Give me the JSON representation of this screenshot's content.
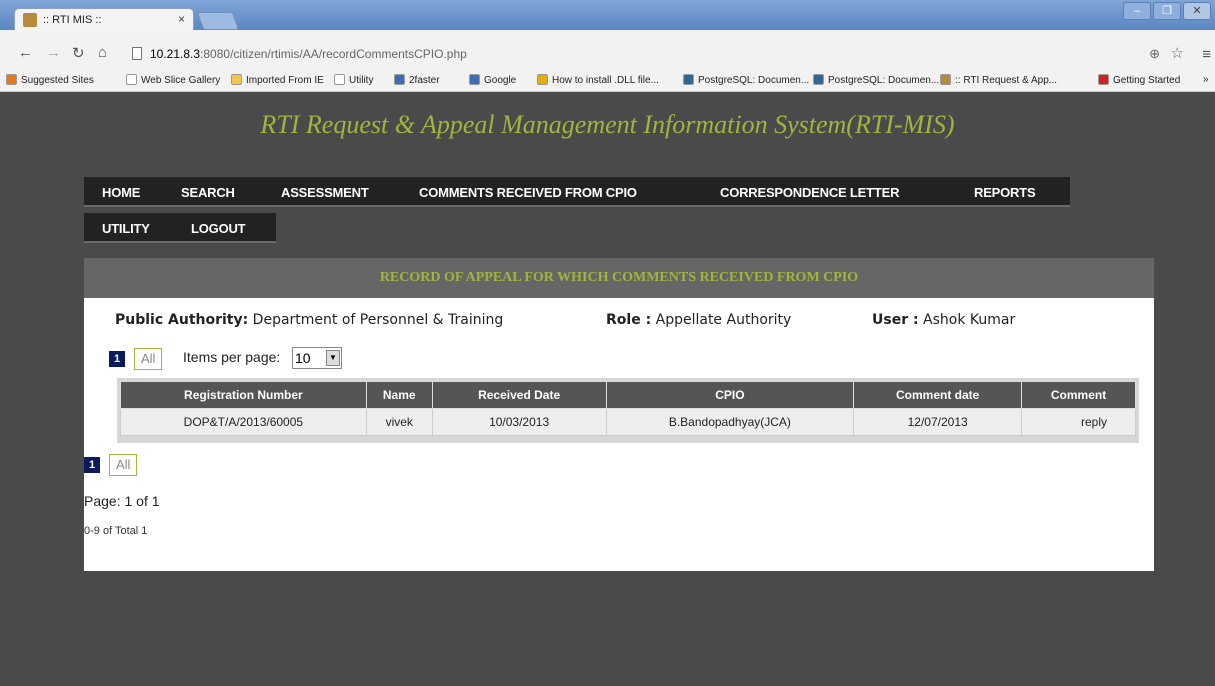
{
  "browser": {
    "tab_title": ":: RTI MIS ::",
    "tab_close": "×",
    "url_host": "10.21.8.3",
    "url_rest": ":8080/citizen/rtimis/AA/recordCommentsCPIO.php",
    "bookmarks": [
      {
        "label": "Suggested Sites",
        "color": "#e8791c"
      },
      {
        "label": "Web Slice Gallery",
        "color": "#ffffff"
      },
      {
        "label": "Imported From IE",
        "color": "#f0c84a"
      },
      {
        "label": "Utility",
        "color": "#ffffff"
      },
      {
        "label": "2faster",
        "color": "#3d6db5"
      },
      {
        "label": "Google",
        "color": "#3d6db5"
      },
      {
        "label": "How to install .DLL file...",
        "color": "#e0b000"
      },
      {
        "label": "PostgreSQL: Documen...",
        "color": "#336791"
      },
      {
        "label": "PostgreSQL: Documen...",
        "color": "#336791"
      },
      {
        "label": ":: RTI Request & App...",
        "color": "#b58b3c"
      },
      {
        "label": "Getting Started",
        "color": "#d42020"
      }
    ],
    "more_bookmarks": "»"
  },
  "header": {
    "title": "RTI Request & Appeal Management Information System(RTI-MIS)"
  },
  "menu": {
    "row1": [
      "HOME",
      "SEARCH",
      "ASSESSMENT",
      "COMMENTS RECEIVED FROM CPIO",
      "CORRESPONDENCE LETTER",
      "REPORTS"
    ],
    "row2": [
      "UTILITY",
      "LOGOUT"
    ]
  },
  "panel": {
    "heading": "RECORD OF APPEAL FOR WHICH COMMENTS RECEIVED FROM CPIO",
    "public_authority_label": "Public Authority:",
    "public_authority_value": "Department of Personnel & Training",
    "role_label": "Role :",
    "role_value": "Appellate Authority",
    "user_label": "User :",
    "user_value": "Ashok Kumar"
  },
  "pagination": {
    "current_page": "1",
    "all_label": "All",
    "items_per_page_label": "Items per page:",
    "items_per_page_value": "10",
    "page_count": "Page: 1 of 1",
    "total": "0-9 of Total 1"
  },
  "table": {
    "columns": [
      "Registration Number",
      "Name",
      "Received Date",
      "CPIO",
      "Comment date",
      "Comment"
    ],
    "rows": [
      [
        "DOP&T/A/2013/60005",
        "vivek",
        "10/03/2013",
        "B.Bandopadhyay(JCA)",
        "12/07/2013",
        "reply"
      ]
    ]
  },
  "colors": {
    "accent": "#a2b43e",
    "page_bg": "#4a4a4a",
    "menu_bg": "#222222",
    "pager_active": "#0a1a5c"
  }
}
